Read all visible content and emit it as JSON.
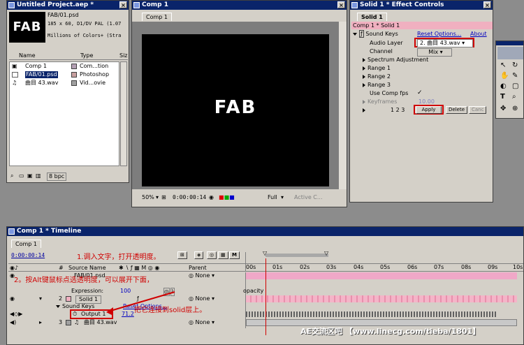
{
  "project": {
    "title": "Untitled Project.aep *",
    "thumb_text": "FAB",
    "info_name": "FAB/01.psd",
    "info_size": "185 x 60, D1/DV PAL (1.07",
    "info_colors": "Millions of Colors+ (Stra",
    "col_name": "Name",
    "col_type": "Type",
    "col_size": "Siz",
    "items": [
      {
        "name": "Comp 1",
        "type": "Com...tion",
        "color": "#b4a0b4"
      },
      {
        "name": "FAB/01.psd",
        "type": "Photoshop",
        "color": "#c8a0a0"
      },
      {
        "name": "曲目 43.wav",
        "type": "Vid...ovie",
        "color": "#a0a0a0"
      }
    ],
    "bpc": "8 bpc"
  },
  "comp": {
    "title": "Comp 1",
    "tab": "Comp 1",
    "logo_text": "FAB",
    "zoom": "50%",
    "timecode": "0:00:00:14",
    "resolution": "Full",
    "camera": "Active C..."
  },
  "effects": {
    "title": "Solid 1 * Effect Controls",
    "tab": "Solid 1",
    "breadcrumb": "Comp 1 * Solid 1",
    "effect_name": "Sound Keys",
    "reset": "Reset Options...",
    "about": "About",
    "audio_layer_label": "Audio Layer",
    "audio_layer_value": "2. 曲目 43.wav",
    "channel_label": "Channel",
    "channel_value": "Mix",
    "spectrum": "Spectrum Adjustment",
    "range1": "Range 1",
    "range2": "Range 2",
    "range3": "Range 3",
    "use_fps": "Use Comp fps",
    "keyframes_label": "Keyframes",
    "keyframes_value": "10.00",
    "range_nums": "1 2 3",
    "apply": "Apply",
    "delete": "Delete",
    "cancel": "Canc"
  },
  "timeline": {
    "title": "Comp 1 * Timeline",
    "tab": "Comp 1",
    "timecode": "0:00:00:14",
    "col_num": "#",
    "col_source": "Source Name",
    "col_parent": "Parent",
    "ticks": [
      "00s",
      "01s",
      "02s",
      "03s",
      "04s",
      "05s",
      "06s",
      "07s",
      "08s",
      "09s",
      "10s"
    ],
    "layers": [
      {
        "num": "1",
        "name": "FAB/01.psd",
        "parent": "None"
      },
      {
        "num": "2",
        "name": "Solid 1",
        "parent": "None"
      },
      {
        "num": "3",
        "name": "曲目 43.wav",
        "parent": "None"
      }
    ],
    "expr_label": "Expression:",
    "expr_value": "100",
    "opacity_text": "opacity",
    "sound_keys": "Sound Keys",
    "sk_reset": "Reset Options...",
    "output_label": "Output 1",
    "output_value": "71.2"
  },
  "annotations": {
    "step1": "1.调入文字，打开透明度。",
    "step2": "2。按Alt键鼠标点选透明度，可以展开下面，",
    "step3": "把它连接到solid层上。"
  },
  "watermark": "AE交流区吧 【www.linecg.com/tieba/1801】",
  "colors": {
    "titlebar": "#0a246a",
    "annotation": "#d00000",
    "layer_pink": "#f0a8c8"
  }
}
